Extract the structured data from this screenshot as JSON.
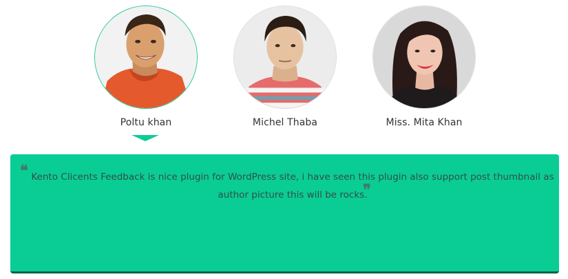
{
  "authors": [
    {
      "name": "Poltu khan",
      "active": true
    },
    {
      "name": "Michel Thaba",
      "active": false
    },
    {
      "name": "Miss. Mita Khan",
      "active": false
    }
  ],
  "feedback": {
    "open_quote": "❝",
    "close_quote": "❞",
    "text": "Kento Clicents Feedback is nice plugin for WordPress site, i have seen this plugin also support post thumbnail as author picture this will be rocks."
  },
  "colors": {
    "accent": "#0acd95",
    "active_ring": "#25c59a",
    "panel_shadow": "#0a6448"
  }
}
